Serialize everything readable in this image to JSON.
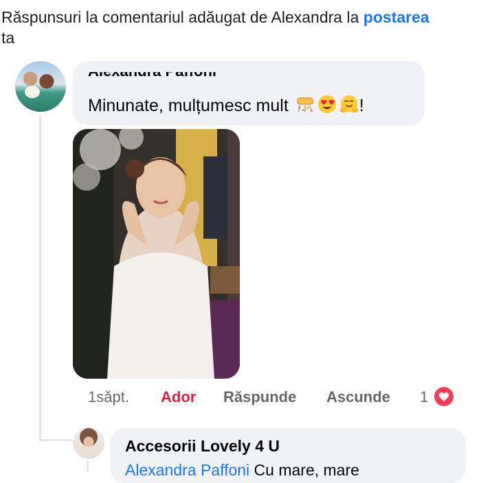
{
  "header": {
    "prefix": "Răspunsuri la comentariul adăugat de Alexandra la ",
    "link": "postarea",
    "suffix": "ta"
  },
  "comment": {
    "author_partial": "Alexandra Paffoni",
    "text": "Minunate, mulțumesc mult ",
    "emojis": [
      "confetti-emoji",
      "heart-eyes-emoji",
      "hugging-face-emoji"
    ],
    "end_punct": "!",
    "photo": "bride-in-white-dress-photo"
  },
  "actions": {
    "time": "1săpt.",
    "like": "Ador",
    "reply": "Răspunde",
    "hide": "Ascunde",
    "reaction_count": "1",
    "reaction_icon": "heart-icon"
  },
  "reply": {
    "author": "Accesorii  Lovely 4 U",
    "mention": "Alexandra Paffoni",
    "text": " Cu mare, mare"
  },
  "colors": {
    "link": "#1877f2",
    "love": "#e41e3f",
    "bubble": "#f0f2f5",
    "muted": "#65676b"
  }
}
